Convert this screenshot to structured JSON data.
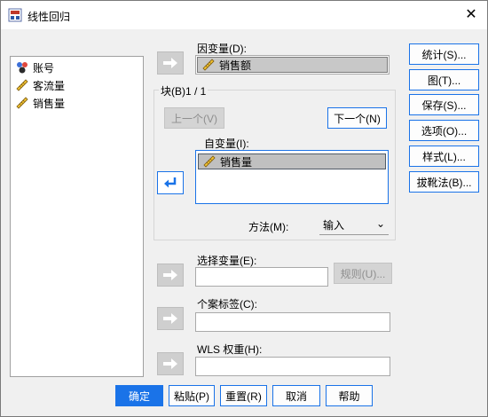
{
  "window": {
    "title": "线性回归",
    "close_glyph": "✕"
  },
  "source_list": {
    "items": [
      {
        "label": "账号",
        "icon": "nominal-variable-icon"
      },
      {
        "label": "客流量",
        "icon": "scale-ruler-icon"
      },
      {
        "label": "销售量",
        "icon": "scale-ruler-icon"
      }
    ]
  },
  "dependent": {
    "label": "因变量(D):",
    "value": "销售额"
  },
  "block": {
    "label": "块(B)1 / 1",
    "prev_label": "上一个(V)",
    "next_label": "下一个(N)"
  },
  "independent": {
    "label": "自变量(I):",
    "items": [
      "销售量"
    ]
  },
  "method": {
    "label": "方法(M):",
    "value": "输入",
    "chevron": "⌄"
  },
  "selection": {
    "label": "选择变量(E):",
    "rule_label": "规则(U)..."
  },
  "case_label": {
    "label": "个案标签(C):"
  },
  "wls": {
    "label": "WLS 权重(H):"
  },
  "right_buttons": [
    "统计(S)...",
    "图(T)...",
    "保存(S)...",
    "选项(O)...",
    "样式(L)...",
    "拔靴法(B)..."
  ],
  "bottom_buttons": {
    "ok": "确定",
    "paste": "粘贴(P)",
    "reset": "重置(R)",
    "cancel": "取消",
    "help": "帮助"
  },
  "colors": {
    "accent": "#1a73e8",
    "selected_row": "#c8c8c8",
    "disabled_arrow": "#cfcfcf"
  }
}
